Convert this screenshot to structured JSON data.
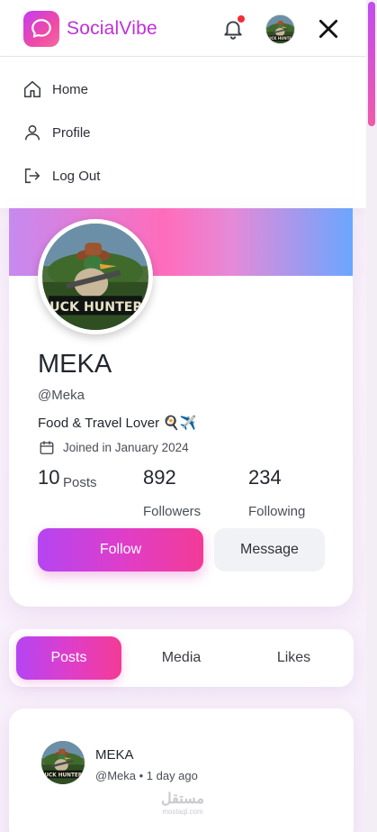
{
  "app": {
    "brand": "SocialVibe"
  },
  "colors": {
    "accent": "#c030d8",
    "gradient_start": "#b545f2",
    "gradient_end": "#f33b96",
    "notification": "#ef2d3b"
  },
  "header": {
    "logo_icon": "chat-bubble-icon",
    "notification_icon": "bell-icon",
    "has_unread_notification": true,
    "close_icon": "close-icon"
  },
  "menu": {
    "items": [
      {
        "label": "Home",
        "icon": "home-icon"
      },
      {
        "label": "Profile",
        "icon": "user-icon"
      },
      {
        "label": "Log Out",
        "icon": "logout-icon"
      }
    ]
  },
  "profile": {
    "avatar_text": "DUCK HUNTERS",
    "name": "MEKA",
    "handle": "@Meka",
    "bio": "Food & Travel Lover",
    "bio_emojis": "🍳✈️",
    "joined": "Joined in January 2024",
    "stats": {
      "posts_count": "10",
      "posts_label": "Posts",
      "followers_count": "892",
      "followers_label": "Followers",
      "following_count": "234",
      "following_label": "Following"
    },
    "follow_label": "Follow",
    "message_label": "Message"
  },
  "tabs": [
    {
      "label": "Posts",
      "active": true
    },
    {
      "label": "Media",
      "active": false
    },
    {
      "label": "Likes",
      "active": false
    }
  ],
  "post": {
    "author": "MEKA",
    "meta": "@Meka • 1 day ago"
  },
  "watermark": {
    "text": "مستقل",
    "sub": "mostaql.com"
  }
}
